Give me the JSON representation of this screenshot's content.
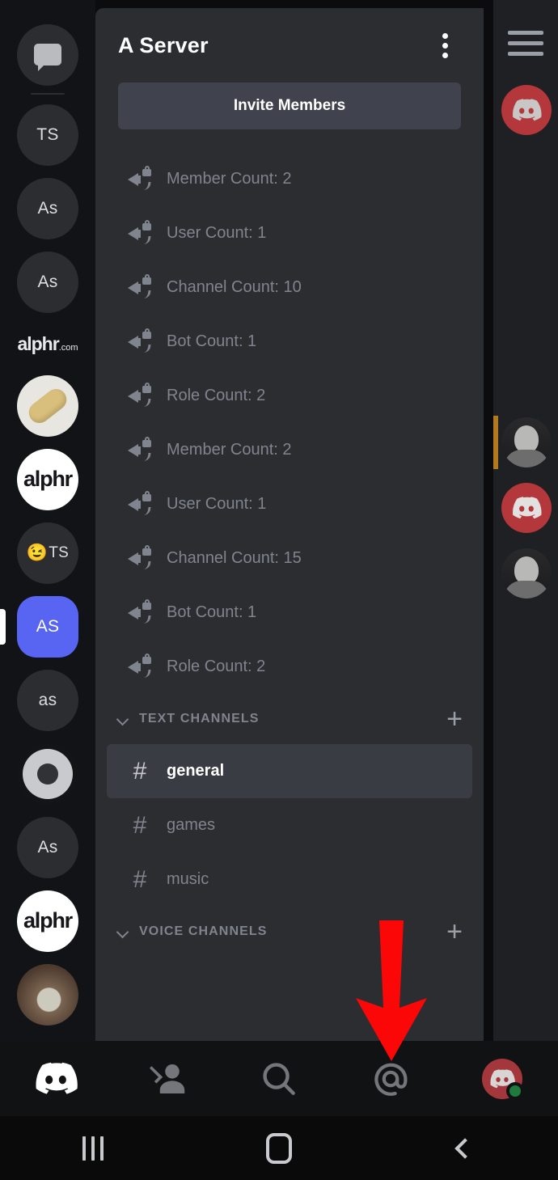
{
  "server_rail": {
    "home_icon": "direct-messages-icon",
    "items": [
      {
        "label": "TS",
        "type": "initials"
      },
      {
        "label": "As",
        "type": "initials"
      },
      {
        "label": "As",
        "type": "initials"
      },
      {
        "label": "",
        "type": "photo-bread"
      },
      {
        "label": "alphr",
        "type": "logo"
      },
      {
        "label": "TS",
        "type": "emoji-initials",
        "emoji": "😉"
      },
      {
        "label": "AS",
        "type": "initials",
        "active": true
      },
      {
        "label": "as",
        "type": "initials"
      },
      {
        "label": "",
        "type": "ring-logo"
      },
      {
        "label": "As",
        "type": "initials"
      },
      {
        "label": "alphr",
        "type": "logo"
      },
      {
        "label": "",
        "type": "photo-animal"
      }
    ],
    "watermark": "alphr",
    "watermark_suffix": ".com"
  },
  "panel": {
    "title": "A Server",
    "more_icon": "overflow-menu-icon",
    "invite_label": "Invite Members",
    "locked_channels": [
      "Member Count: 2",
      "User Count: 1",
      "Channel Count: 10",
      "Bot Count: 1",
      "Role Count: 2",
      "Member Count: 2",
      "User Count: 1",
      "Channel Count: 15",
      "Bot Count: 1",
      "Role Count: 2"
    ],
    "text_category": {
      "label": "TEXT CHANNELS",
      "add_label": "+",
      "channels": [
        {
          "name": "general",
          "selected": true
        },
        {
          "name": "games",
          "selected": false
        },
        {
          "name": "music",
          "selected": false
        }
      ]
    },
    "voice_category": {
      "label": "VOICE CHANNELS",
      "add_label": "+"
    }
  },
  "right_panel": {
    "menu_icon": "hamburger-menu-icon",
    "members": [
      {
        "type": "discord-avatar"
      },
      {
        "type": "person-avatar",
        "unread": true
      },
      {
        "type": "discord-avatar"
      },
      {
        "type": "person-avatar"
      }
    ]
  },
  "tabbar": {
    "tabs": [
      {
        "name": "home",
        "icon": "discord-logo-icon",
        "active": true
      },
      {
        "name": "friends",
        "icon": "friends-icon",
        "active": false
      },
      {
        "name": "search",
        "icon": "search-icon",
        "active": false
      },
      {
        "name": "mentions",
        "icon": "mention-at-icon",
        "active": false
      },
      {
        "name": "profile",
        "icon": "user-avatar-icon",
        "active": false
      }
    ],
    "status": "online"
  },
  "android_nav": {
    "recents_label": "recents-icon",
    "home_label": "home-icon",
    "back_label": "back-icon"
  },
  "annotation": {
    "type": "arrow",
    "direction": "down",
    "color": "#fb0707",
    "points_to": "mentions"
  },
  "colors": {
    "panel_bg": "#2b2d31",
    "rail_bg": "#121316",
    "selected_row": "#3a3c43",
    "invite_btn": "#40434e",
    "muted_text": "#80848e",
    "accent_blurple": "#5865f2",
    "online_green": "#1f7a3d",
    "unread_amber": "#b2791f",
    "annotation_red": "#fb0707"
  }
}
